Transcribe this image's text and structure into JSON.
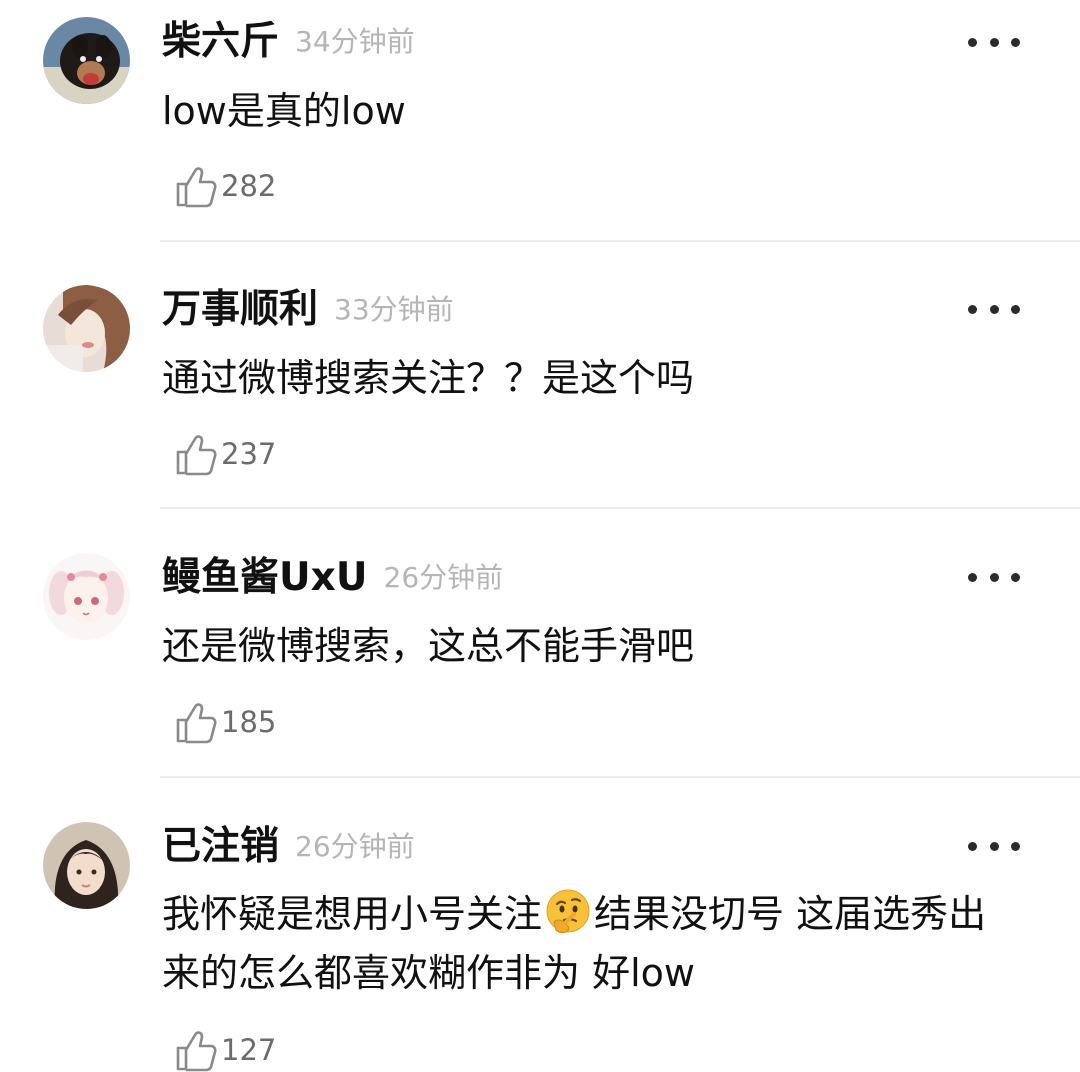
{
  "comments": [
    {
      "name": "柴六斤",
      "time": "34分钟前",
      "text": "low是真的low",
      "likes": "282",
      "avatar": "dog-photo"
    },
    {
      "name": "万事顺利",
      "time": "33分钟前",
      "text": "通过微博搜索关注？？是这个吗",
      "likes": "237",
      "avatar": "girl-photo"
    },
    {
      "name": "鳗鱼酱UxU",
      "time": "26分钟前",
      "text": "还是微博搜索，这总不能手滑吧",
      "likes": "185",
      "avatar": "anime-girl-illustration"
    },
    {
      "name": "已注销",
      "time": "26分钟前",
      "text_before_emoji": "我怀疑是想用小号关注",
      "emoji": "thinking-face",
      "text_after_emoji": "结果没切号 这届选秀出来的怎么都喜欢糊作非为 好low",
      "likes": "127",
      "avatar": "girl-selfie"
    }
  ],
  "colors": {
    "name": "#111111",
    "time": "#b5b5b5",
    "like_count": "#6b6b6b",
    "divider": "#ececec"
  }
}
